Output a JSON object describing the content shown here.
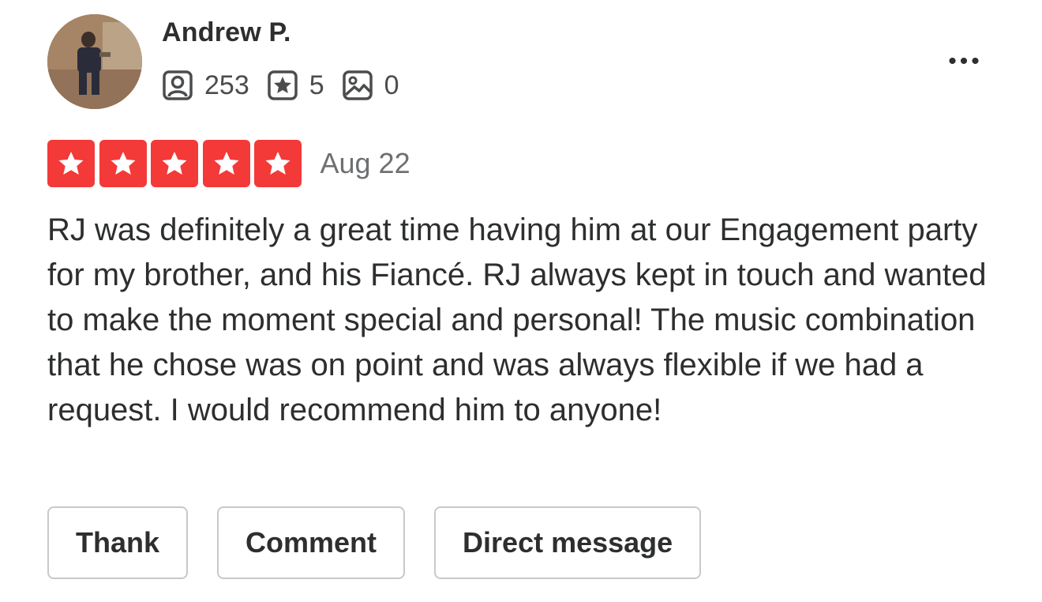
{
  "reviewer": {
    "name": "Andrew P.",
    "stats": [
      {
        "icon": "friends-icon",
        "value": "253"
      },
      {
        "icon": "reviews-star-icon",
        "value": "5"
      },
      {
        "icon": "photos-icon",
        "value": "0"
      }
    ]
  },
  "review": {
    "rating": 5,
    "max_rating": 5,
    "date": "Aug 22",
    "text": "RJ was definitely a great time having him at our Engagement party for my brother, and his Fiancé. RJ always kept in touch and wanted to make the moment special and personal! The music combination that he chose was on point and was always flexible if we had a request. I would recommend him to anyone!"
  },
  "actions": {
    "thank_label": "Thank",
    "comment_label": "Comment",
    "direct_message_label": "Direct message"
  },
  "more_menu": {
    "label": "•••"
  },
  "colors": {
    "star_red": "#f43939",
    "text_dark": "#2d2e2f",
    "text_muted": "#6e7072",
    "button_border": "#c8c9ca"
  }
}
